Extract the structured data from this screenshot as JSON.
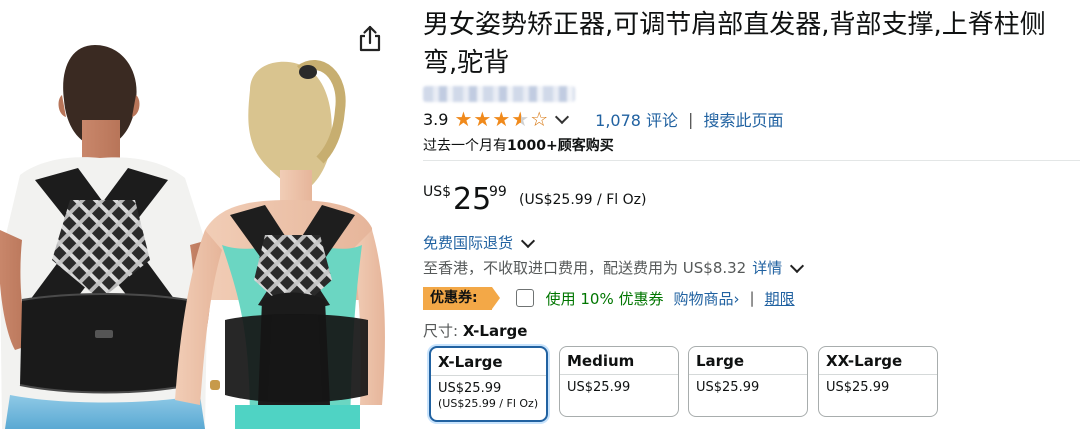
{
  "product": {
    "title": "男女姿势矫正器,可调节肩部直发器,背部支撑,上脊柱侧弯,驼背",
    "share_icon": "share-icon"
  },
  "rating": {
    "value": "3.9",
    "stars": 3.9,
    "reviews_link": "1,078 评论",
    "separator": "|",
    "search_link": "搜索此页面"
  },
  "bought": {
    "prefix": "过去一个月有",
    "count": "1000+顾客购买"
  },
  "price": {
    "symbol": "US$",
    "whole": "25",
    "fraction": "99",
    "unit_price": "(US$25.99 / Fl Oz)"
  },
  "shipping": {
    "returns": "免费国际退货",
    "info": "至香港，不收取进口费用，配送费用为 US$8.32",
    "details_link": "详情"
  },
  "coupon": {
    "badge": "优惠券:",
    "apply": "使用 10% 优惠券",
    "shop_link": "购物商品›",
    "separator": "|",
    "terms": "期限"
  },
  "size": {
    "label": "尺寸:",
    "selected": "X-Large",
    "options": [
      {
        "name": "X-Large",
        "price": "US$25.99",
        "unit": "(US$25.99 / Fl Oz)",
        "selected": true
      },
      {
        "name": "Medium",
        "price": "US$25.99"
      },
      {
        "name": "Large",
        "price": "US$25.99"
      },
      {
        "name": "XX-Large",
        "price": "US$25.99"
      }
    ]
  },
  "colors": {
    "link": "#2162a1",
    "star": "#f08a1c",
    "coupon_badge": "#f3a847",
    "coupon_text": "#007600"
  }
}
